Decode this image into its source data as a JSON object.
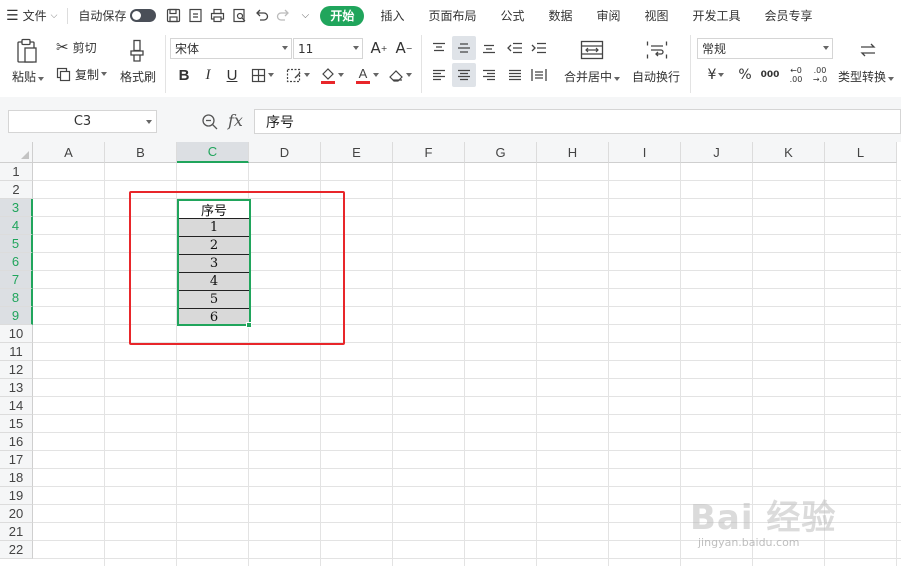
{
  "menubar": {
    "file_label": "文件",
    "autosave_label": "自动保存",
    "tabs": [
      {
        "label": "开始",
        "active": true
      },
      {
        "label": "插入"
      },
      {
        "label": "页面布局"
      },
      {
        "label": "公式"
      },
      {
        "label": "数据"
      },
      {
        "label": "审阅"
      },
      {
        "label": "视图"
      },
      {
        "label": "开发工具"
      },
      {
        "label": "会员专享"
      }
    ]
  },
  "ribbon": {
    "paste_label": "粘贴",
    "cut_label": "剪切",
    "copy_label": "复制",
    "format_painter_label": "格式刷",
    "font_name": "宋体",
    "font_size": "11",
    "merge_center_label": "合并居中",
    "wrap_text_label": "自动换行",
    "number_format": "常规",
    "type_convert_label": "类型转换",
    "currency_symbol": "¥",
    "percent_symbol": "%",
    "thousands_symbol": "000",
    "inc_decimal_top": "←0",
    "inc_decimal_bottom": ".00",
    "dec_decimal_top": ".00",
    "dec_decimal_bottom": "→.0",
    "font_color": "#e8262a",
    "highlight_color": "#e8262a"
  },
  "formula_bar": {
    "cell_ref": "C3",
    "fx_label": "fx",
    "content": "序号"
  },
  "columns": [
    "A",
    "B",
    "C",
    "D",
    "E",
    "F",
    "G",
    "H",
    "I",
    "J",
    "K",
    "L"
  ],
  "rows": [
    "1",
    "2",
    "3",
    "4",
    "5",
    "6",
    "7",
    "8",
    "9",
    "10",
    "11",
    "12",
    "13",
    "14",
    "15",
    "16",
    "17",
    "18",
    "19",
    "20",
    "21",
    "22"
  ],
  "selected_column": "C",
  "selected_rows": [
    "3",
    "4",
    "5",
    "6",
    "7",
    "8",
    "9"
  ],
  "table": {
    "header": "序号",
    "values": [
      "1",
      "2",
      "3",
      "4",
      "5",
      "6"
    ]
  },
  "watermark": {
    "text": "Bai 经验",
    "sub": "jingyan.baidu.com"
  },
  "colors": {
    "accent": "#20a55c",
    "highlight_box": "#e8262a",
    "data_fill": "#d9d9d9"
  }
}
